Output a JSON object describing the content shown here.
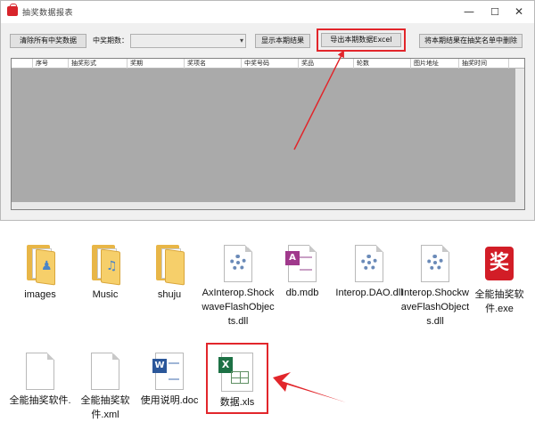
{
  "window": {
    "title": "抽奖数据报表",
    "controls": {
      "minimize": "—",
      "maximize": "☐",
      "close": "✕"
    }
  },
  "toolbar": {
    "clear_label": "清除所有中奖数据",
    "period_label": "中奖期数：",
    "period_value": "",
    "show_label": "显示本期结果",
    "export_label": "导出本期数据Excel",
    "remove_label": "将本期结果在抽奖名单中删除"
  },
  "table": {
    "columns": [
      "",
      "序号",
      "抽奖形式",
      "奖期",
      "奖项名",
      "中奖号码",
      "奖品",
      "轮数",
      "图片地址",
      "抽奖时间"
    ],
    "rows": []
  },
  "files": [
    {
      "name": "images",
      "kind": "folder"
    },
    {
      "name": "Music",
      "kind": "folder"
    },
    {
      "name": "shuju",
      "kind": "folder"
    },
    {
      "name": "AxInterop.ShockwaveFlashObjects.dll",
      "kind": "dll"
    },
    {
      "name": "db.mdb",
      "kind": "mdb"
    },
    {
      "name": "Interop.DAO.dll",
      "kind": "dll"
    },
    {
      "name": "Interop.ShockwaveFlashObjects.dll",
      "kind": "dll"
    },
    {
      "name": "全能抽奖软件.exe",
      "kind": "exe"
    },
    {
      "name": "全能抽奖软件.",
      "kind": "file"
    },
    {
      "name": "全能抽奖软件.xml",
      "kind": "file"
    },
    {
      "name": "使用说明.doc",
      "kind": "doc"
    },
    {
      "name": "数据.xls",
      "kind": "xls"
    }
  ],
  "icon_glyphs": {
    "exe_char": "奖",
    "word_char": "W",
    "excel_char": "X",
    "mdb_char": "A"
  },
  "colors": {
    "highlight": "#e2262b",
    "excel": "#1d7145",
    "word": "#2b579a",
    "exe": "#d21d27",
    "folder": "#f6cf6a"
  }
}
